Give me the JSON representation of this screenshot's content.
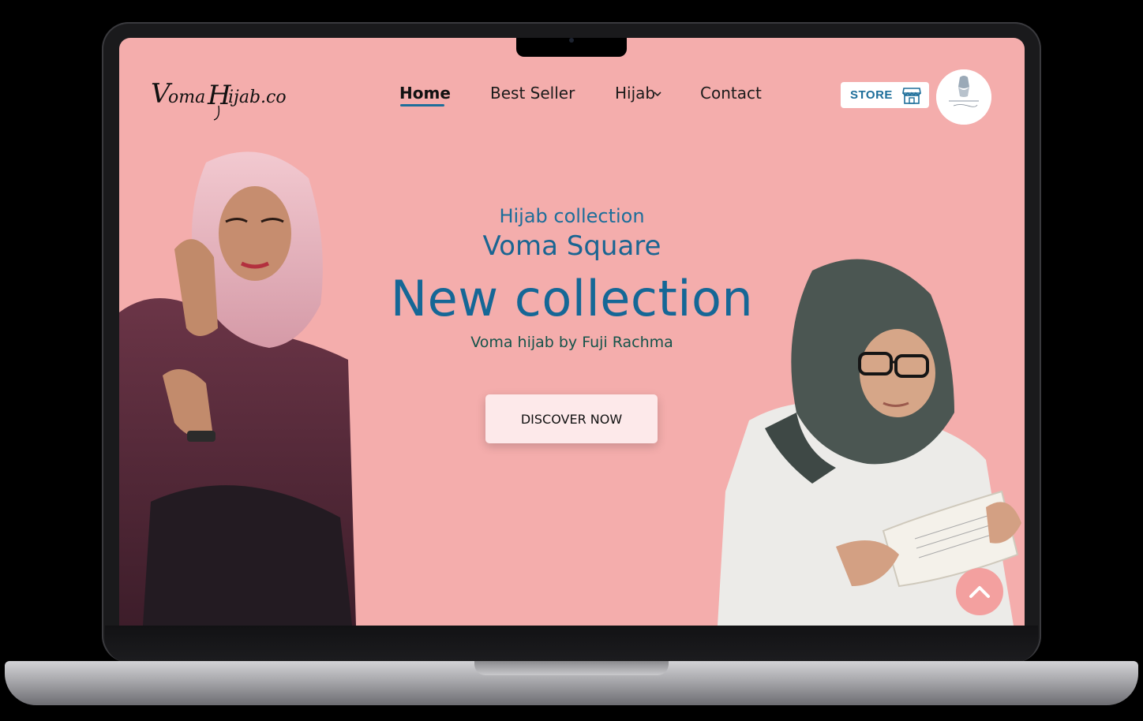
{
  "brand": {
    "logo_text": "Voma Hijab.co"
  },
  "nav": {
    "items": [
      {
        "label": "Home",
        "active": true
      },
      {
        "label": "Best Seller"
      },
      {
        "label": "Hijab",
        "has_dropdown": true
      },
      {
        "label": "Contact"
      }
    ]
  },
  "store": {
    "label": "STORE",
    "icon": "store-icon"
  },
  "avatar": {
    "icon": "brand-avatar"
  },
  "hero": {
    "eyebrow": "Hijab collection",
    "brand_name": "Voma Square",
    "headline": "New collection",
    "byline": "Voma hijab by Fuji Rachma",
    "cta_label": "DISCOVER NOW"
  },
  "scroll_top": {
    "icon": "chevron-up-icon"
  },
  "colors": {
    "background": "#f4adac",
    "accent": "#1d6e9a",
    "cta_bg": "#fde9ea"
  }
}
